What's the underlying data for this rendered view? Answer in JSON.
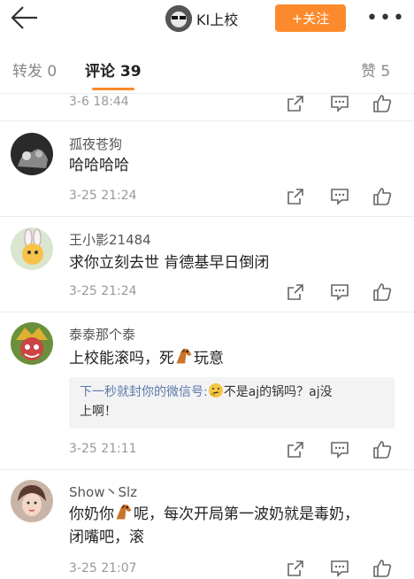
{
  "header": {
    "username": "KI上校",
    "follow_label": "+关注",
    "more_label": "•••"
  },
  "tabs": {
    "repost": "转发 0",
    "comments": "评论 39",
    "likes": "赞 5"
  },
  "prev_comment": {
    "time": "3-6 18:44"
  },
  "comments": [
    {
      "name": "孤夜苍狗",
      "text": "哈哈哈哈",
      "time": "3-25 21:24"
    },
    {
      "name": "王小影21484",
      "text": "求你立刻去世 肯德基早日倒闭",
      "time": "3-25 21:24"
    },
    {
      "name": "泰泰那个泰",
      "text_before": "上校能滚吗，死",
      "text_after": "玩意",
      "reply": {
        "user": "下一秒就封你的微信号:",
        "text_line1": "不是aj的锅吗？aj没",
        "text_line2": "上啊！"
      },
      "time": "3-25 21:11"
    },
    {
      "name": "Show丶Slz",
      "text_before": "你奶你",
      "text_after": "呢，每次开局第一波奶就是毒奶，",
      "text_line2": "闭嘴吧，滚",
      "time": "3-25 21:07"
    }
  ],
  "colors": {
    "accent": "#fc8a2d",
    "link": "#5b7aa8"
  },
  "icons": [
    "back-arrow-icon",
    "share-icon",
    "comment-icon",
    "like-icon",
    "horse-emoji-icon",
    "thinking-emoji-icon"
  ]
}
